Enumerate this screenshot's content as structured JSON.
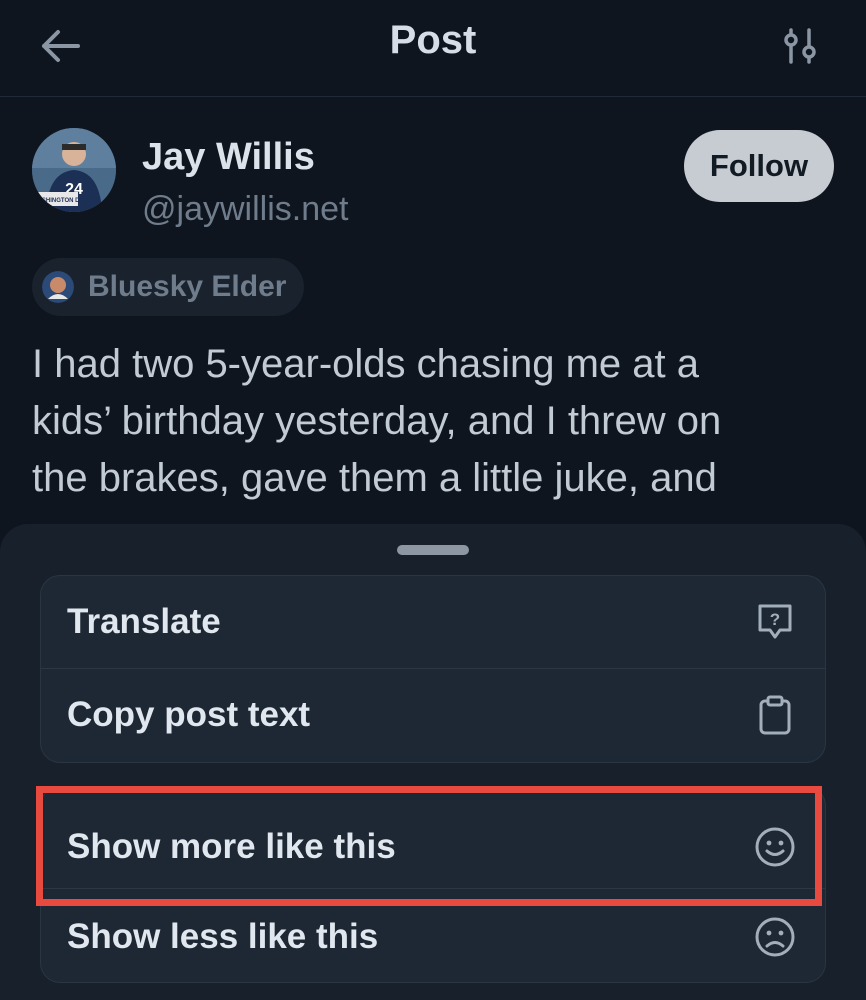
{
  "header": {
    "title": "Post",
    "back_icon": "arrow-left-icon",
    "filter_icon": "sliders-icon"
  },
  "author": {
    "name": "Jay Willis",
    "handle": "@jaywillis.net",
    "follow_label": "Follow",
    "badge_label": "Bluesky Elder",
    "avatar_jersey_number": "24",
    "avatar_sign_text": "WASHINGTON DC"
  },
  "post": {
    "lines": [
      "I had two 5-year-olds chasing me at a",
      "kids’ birthday yesterday, and I threw on",
      "the brakes, gave them a little juke, and"
    ]
  },
  "menu": {
    "group1": [
      {
        "label": "Translate",
        "icon": "translate-question-icon"
      },
      {
        "label": "Copy post text",
        "icon": "clipboard-icon"
      }
    ],
    "group2": [
      {
        "label": "Show more like this",
        "icon": "smile-icon"
      },
      {
        "label": "Show less like this",
        "icon": "frown-icon"
      }
    ]
  },
  "colors": {
    "background": "#0f151e",
    "sheet": "#17202b",
    "highlight": "#e84a3f",
    "follow_bg": "#c7ccd2"
  }
}
